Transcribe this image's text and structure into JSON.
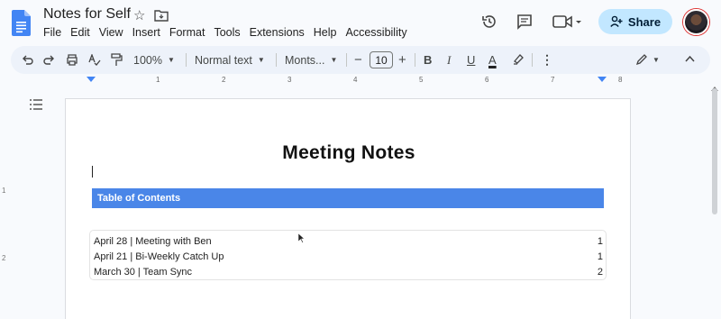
{
  "header": {
    "title": "Notes for Self",
    "menu": [
      "File",
      "Edit",
      "View",
      "Insert",
      "Format",
      "Tools",
      "Extensions",
      "Help",
      "Accessibility"
    ],
    "share_label": "Share"
  },
  "toolbar": {
    "zoom": "100%",
    "style": "Normal text",
    "font": "Monts...",
    "font_size": "10",
    "font_size_minus": "−",
    "font_size_plus": "+",
    "bold": "B",
    "italic": "I",
    "underline": "U",
    "text_color": "A"
  },
  "ruler": {
    "h_numbers": [
      "1",
      "2",
      "3",
      "4",
      "5",
      "6",
      "7",
      "8"
    ],
    "v_numbers": [
      "1",
      "2"
    ]
  },
  "document": {
    "heading": "Meeting Notes",
    "toc_title": "Table of Contents",
    "toc": [
      {
        "text": "April 28 | Meeting with Ben",
        "page": "1"
      },
      {
        "text": "April 21 | Bi-Weekly Catch Up",
        "page": "1"
      },
      {
        "text": "March 30 | Team Sync",
        "page": "2"
      }
    ]
  },
  "colors": {
    "accent": "#4a86e8",
    "share_bg": "#c2e7ff",
    "toolbar_bg": "#edf2fa"
  }
}
